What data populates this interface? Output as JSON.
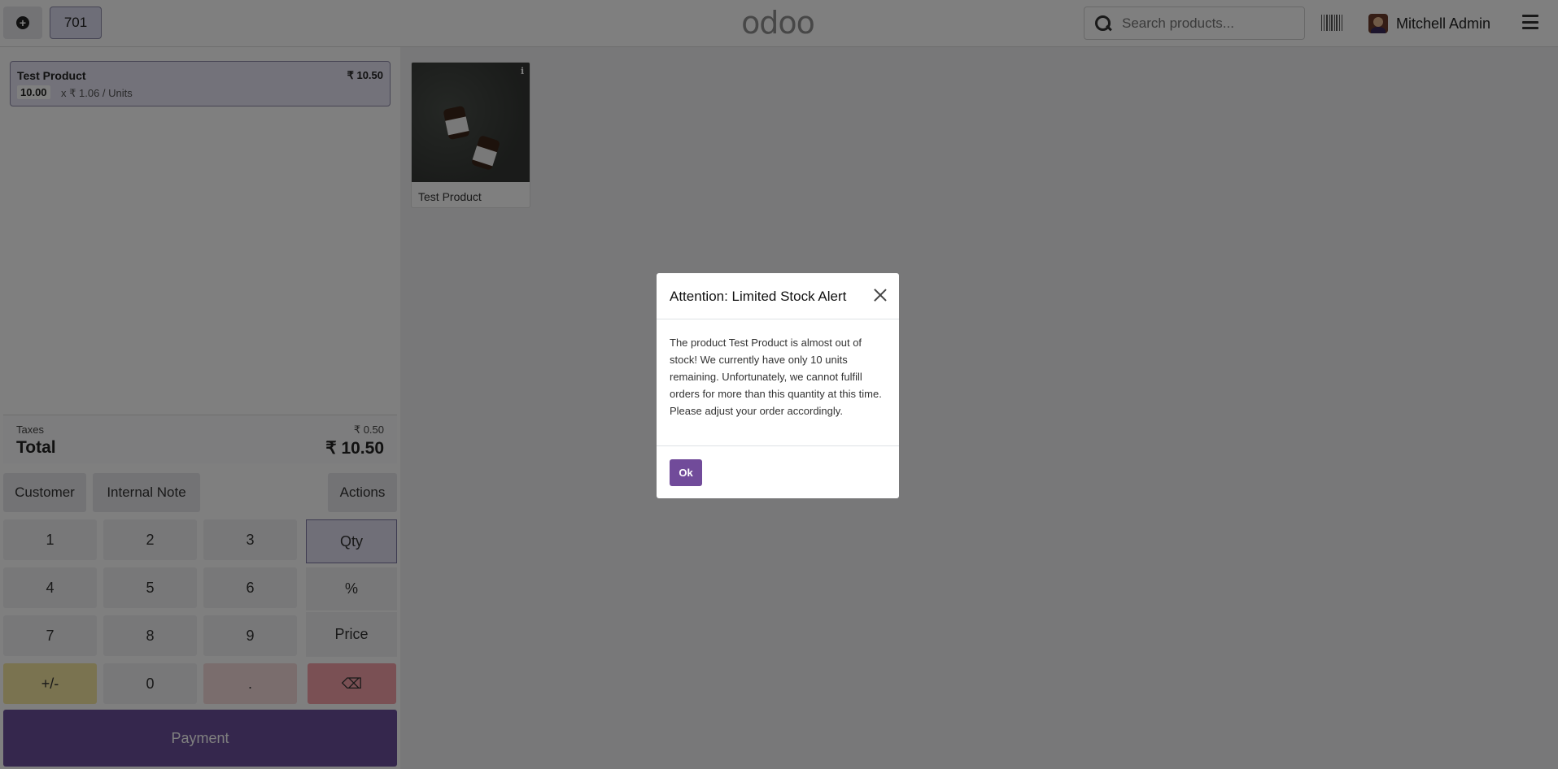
{
  "topbar": {
    "order_number": "701",
    "logo_text": "odoo",
    "search_placeholder": "Search products...",
    "user_name": "Mitchell Admin"
  },
  "order": {
    "lines": [
      {
        "name": "Test Product",
        "price": "₹ 10.50",
        "qty": "10.00",
        "unit_info": "x ₹ 1.06 / Units"
      }
    ],
    "taxes_label": "Taxes",
    "taxes_value": "₹ 0.50",
    "total_label": "Total",
    "total_value": "₹ 10.50"
  },
  "controls": {
    "customer": "Customer",
    "internal_note": "Internal Note",
    "actions": "Actions"
  },
  "numpad": {
    "k1": "1",
    "k2": "2",
    "k3": "3",
    "k4": "4",
    "k5": "5",
    "k6": "6",
    "k7": "7",
    "k8": "8",
    "k9": "9",
    "sign": "+/-",
    "k0": "0",
    "dot": ".",
    "backspace": "⌫",
    "qty": "Qty",
    "percent": "%",
    "price": "Price"
  },
  "payment_label": "Payment",
  "products": [
    {
      "name": "Test Product",
      "info": "i"
    }
  ],
  "modal": {
    "title": "Attention: Limited Stock Alert",
    "body": "The product Test Product is almost out of stock! We currently have only 10 units remaining. Unfortunately, we cannot fulfill orders for more than this quantity at this time. Please adjust your order accordingly.",
    "ok": "Ok"
  },
  "colors": {
    "brand": "#714b67",
    "payment": "#6b4f9a",
    "ok_button": "#714b9a",
    "backspace": "#f5a0a8",
    "sign": "#f5e6a0"
  }
}
